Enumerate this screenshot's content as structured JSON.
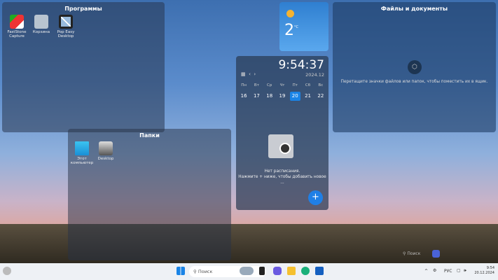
{
  "fences": {
    "programs": {
      "title": "Программы",
      "icons": [
        {
          "label": "FastStone Capture",
          "icon": "faststone-icon"
        },
        {
          "label": "Корзина",
          "icon": "recycle-bin-icon"
        },
        {
          "label": "Pop Easy Desktop",
          "icon": "app-icon"
        }
      ]
    },
    "folders": {
      "title": "Папки",
      "icons": [
        {
          "label": "Этот компьютер",
          "icon": "computer-icon"
        },
        {
          "label": "Desktop",
          "icon": "folder-icon"
        }
      ]
    },
    "files": {
      "title": "Файлы и документы",
      "hint": "Перетащите значки файлов или папок, чтобы поместить их в ящик."
    }
  },
  "weather": {
    "temp": "2",
    "unit": "°C",
    "icon": "sun-icon"
  },
  "calendar": {
    "time": "9:54:37",
    "year_month": "2024.12",
    "weekdays": [
      "Пн",
      "Вт",
      "Ср",
      "Чт",
      "Пт",
      "Сб",
      "Вс"
    ],
    "days": [
      "16",
      "17",
      "18",
      "19",
      "20",
      "21",
      "22"
    ],
    "selected": "20",
    "empty_title": "Нет расписания.",
    "empty_hint": "Нажмите + ниже, чтобы добавить новое ...",
    "add_label": "+"
  },
  "desktop_search": {
    "placeholder": "Поиск"
  },
  "taskbar": {
    "search_placeholder": "Поиск",
    "lang": "РУС",
    "time": "9:54",
    "date": "20.12.2024",
    "accent": "#1a84e6"
  }
}
